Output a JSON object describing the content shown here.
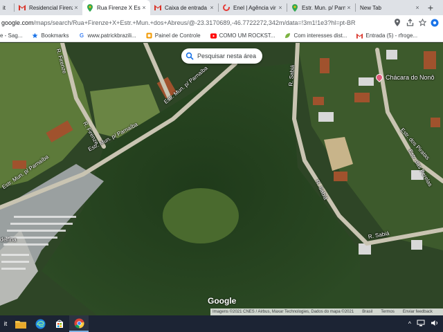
{
  "browser": {
    "tabs": [
      {
        "label": "it",
        "favicon": "tab-fragment-icon",
        "active": false
      },
      {
        "label": "Residencial Firenze",
        "favicon": "gmail-icon",
        "active": false
      },
      {
        "label": "Rua Firenze X Estr.",
        "favicon": "maps-pin-icon",
        "active": true
      },
      {
        "label": "Caixa de entrada",
        "favicon": "gmail-icon",
        "active": false
      },
      {
        "label": "Enel | Agência vir",
        "favicon": "enel-icon",
        "active": false
      },
      {
        "label": "Estr. Mun. p/ Parn",
        "favicon": "maps-pin-icon",
        "active": false
      },
      {
        "label": "New Tab",
        "favicon": "",
        "active": false
      }
    ],
    "new_tab_label": "+",
    "close_glyph": "×",
    "url_host": "google.com",
    "url_path": "/maps/search/Rua+Firenze+X+Estr.+Mun.+dos+Abreus/@-23.3170689,-46.7722272,342m/data=!3m1!1e3?hl=pt-BR",
    "bookmarks": [
      {
        "label": "e - Sag...",
        "icon": "bookmark-fragment-icon"
      },
      {
        "label": "Bookmarks",
        "icon": "star-icon"
      },
      {
        "label": "www.patrickbrazili...",
        "icon": "google-g-icon"
      },
      {
        "label": "Painel de Controle",
        "icon": "panel-icon"
      },
      {
        "label": "COMO UM ROCKST...",
        "icon": "youtube-icon"
      },
      {
        "label": "Com interesses dist...",
        "icon": "leaf-icon"
      },
      {
        "label": "Entrada (5) - rfroge...",
        "icon": "gmail-icon"
      }
    ]
  },
  "map": {
    "search_area_label": "Pesquisar nesta área",
    "place_label": "Chácara do Nonô",
    "road_labels": {
      "r_firenze_top": "R. Firenze",
      "r_firenze_mid": "R. Firenze",
      "estr_parnaiba_top": "Estr. Mun. p/ Parnaíba",
      "estr_parnaiba_mid": "Estr. Mun. p/ Parnaíba",
      "estr_parnaiba_left": "Estr. Mun. p/ Parnaíba",
      "r_sabia_top": "R. Sabiá",
      "r_sabia_mid": "R. Sabiá",
      "r_sabia_bottom": "R. Sabiá",
      "estr_piratas": "Estr. dos Piratas",
      "estr_perelas": "Estr. das Perelas",
      "edge_left": "delfina"
    },
    "google_logo": "Google",
    "attribution": "Imagens ©2021 CNES / Airbus, Maxar Technologies, Dados do mapa ©2021",
    "footer_links": [
      "Brasil",
      "Termos",
      "Enviar feedback"
    ]
  },
  "taskbar": {
    "start_fragment": "it",
    "tray_chevron": "^"
  },
  "colors": {
    "tab_strip": "#dee1e6",
    "taskbar": "#1c2434",
    "pin": "#e05a7a"
  }
}
